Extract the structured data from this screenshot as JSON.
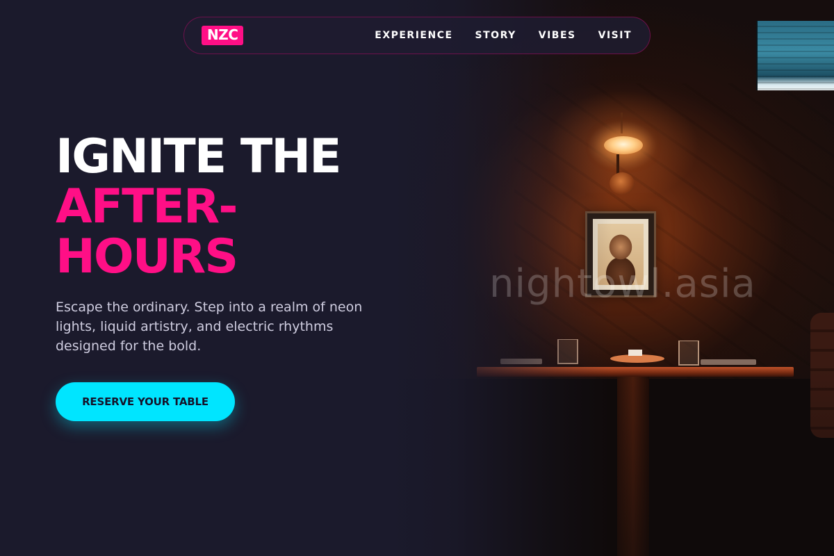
{
  "brand": {
    "logo_text": "NZC"
  },
  "nav": {
    "links": [
      {
        "label": "EXPERIENCE"
      },
      {
        "label": "STORY"
      },
      {
        "label": "VIBES"
      },
      {
        "label": "VISIT"
      }
    ]
  },
  "hero": {
    "headline_line1": "IGNITE THE",
    "headline_line2": "AFTER-",
    "headline_line3": "HOURS",
    "subcopy": "Escape the ordinary. Step into a realm of neon lights, liquid artistry, and electric rhythms designed for the bold.",
    "cta_label": "RESERVE YOUR TABLE"
  },
  "watermark": "nightowl.asia",
  "colors": {
    "background": "#1b1a2c",
    "accent_pink": "#ff0f86",
    "accent_cyan": "#00e5ff",
    "text_white": "#ffffff",
    "text_muted": "#cfcde0"
  }
}
